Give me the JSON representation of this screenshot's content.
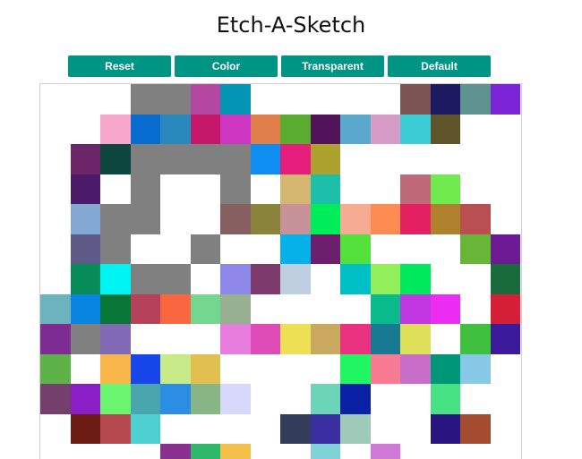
{
  "title": "Etch-A-Sketch",
  "accent_color": "#009485",
  "buttons": {
    "reset": "Reset",
    "color": "Color",
    "transparent": "Transparent",
    "default": "Default"
  },
  "grid": {
    "columns": 16,
    "rows": [
      [
        "#ffffff",
        "#ffffff",
        "#ffffff",
        "#808080",
        "#808080",
        "#b347a1",
        "#0494b4",
        "#ffffff",
        "#ffffff",
        "#ffffff",
        "#ffffff",
        "#ffffff",
        "#7c5451",
        "#1e1a62",
        "#5e9390",
        "#7b23d6"
      ],
      [
        "#ffffff",
        "#ffffff",
        "#f7a7cb",
        "#076bd0",
        "#2a89bc",
        "#c6186a",
        "#cc36c0",
        "#e17f4c",
        "#5aac31",
        "#51145a",
        "#5ba8cd",
        "#d69bc7",
        "#3dcdd6",
        "#60542b",
        "#ffffff",
        "#ffffff"
      ],
      [
        "#ffffff",
        "#6b2568",
        "#0d463e",
        "#808080",
        "#808080",
        "#808080",
        "#808080",
        "#0f8ef2",
        "#e61d7b",
        "#ada22e",
        "#ffffff",
        "#ffffff",
        "#ffffff",
        "#ffffff",
        "#ffffff",
        "#ffffff"
      ],
      [
        "#ffffff",
        "#4b1a69",
        "#ffffff",
        "#808080",
        "#ffffff",
        "#ffffff",
        "#808080",
        "#ffffff",
        "#d6b771",
        "#1cbfa8",
        "#ffffff",
        "#ffffff",
        "#c06976",
        "#70ea4d",
        "#ffffff",
        "#ffffff"
      ],
      [
        "#ffffff",
        "#83a8d4",
        "#808080",
        "#808080",
        "#ffffff",
        "#ffffff",
        "#866060",
        "#8a843a",
        "#c89299",
        "#00ed5b",
        "#f5ac92",
        "#fc8c52",
        "#e32162",
        "#b0812d",
        "#b94f50",
        "#ffffff"
      ],
      [
        "#ffffff",
        "#5e5a88",
        "#808080",
        "#ffffff",
        "#ffffff",
        "#808080",
        "#ffffff",
        "#ffffff",
        "#06b0e8",
        "#6c1f6d",
        "#55e13d",
        "#ffffff",
        "#ffffff",
        "#ffffff",
        "#69b537",
        "#6c1b95"
      ],
      [
        "#ffffff",
        "#078b59",
        "#00f4f4",
        "#808080",
        "#808080",
        "#ffffff",
        "#8d87e9",
        "#7c3a6d",
        "#bfcfe0",
        "#ffffff",
        "#00bfc5",
        "#93f05a",
        "#00e85c",
        "#ffffff",
        "#ffffff",
        "#1a6b3c"
      ],
      [
        "#6cb3bd",
        "#0885e0",
        "#077637",
        "#b5415b",
        "#f96741",
        "#73d88e",
        "#98b092",
        "#ffffff",
        "#ffffff",
        "#ffffff",
        "#ffffff",
        "#0abc8b",
        "#c236e1",
        "#ed2cf3",
        "#ffffff",
        "#d51f36"
      ],
      [
        "#7e2b94",
        "#808080",
        "#8269b5",
        "#ffffff",
        "#ffffff",
        "#ffffff",
        "#e77ede",
        "#e04cb7",
        "#eee055",
        "#c8a95f",
        "#ea3380",
        "#177a92",
        "#dfe05a",
        "#ffffff",
        "#3fc13f",
        "#3b1b9c"
      ],
      [
        "#5db347",
        "#ffffff",
        "#f9b64b",
        "#1747ea",
        "#c8ea89",
        "#e2c04f",
        "#ffffff",
        "#ffffff",
        "#ffffff",
        "#ffffff",
        "#20f662",
        "#f87a93",
        "#c86ec9",
        "#009779",
        "#88c9e7",
        "#ffffff"
      ],
      [
        "#753f6d",
        "#8b1ec7",
        "#69f56d",
        "#4aa6ad",
        "#2c8de5",
        "#87b583",
        "#d7d8fb",
        "#ffffff",
        "#ffffff",
        "#6cd5b8",
        "#0a21a5",
        "#ffffff",
        "#ffffff",
        "#47e284",
        "#ffffff",
        "#ffffff"
      ],
      [
        "#ffffff",
        "#6d1c14",
        "#b64950",
        "#4ed0d1",
        "#ffffff",
        "#ffffff",
        "#ffffff",
        "#ffffff",
        "#343c5c",
        "#3a2fa0",
        "#9fc9b9",
        "#ffffff",
        "#ffffff",
        "#28157f",
        "#a54b30",
        "#ffffff"
      ],
      [
        "#ffffff",
        "#ffffff",
        "#ffffff",
        "#ffffff",
        "#8a3090",
        "#2fb76a",
        "#f3c14b",
        "#ffffff",
        "#ffffff",
        "#7fd3d6",
        "#ffffff",
        "#cf79d9",
        "#ffffff",
        "#ffffff",
        "#ffffff",
        "#ffffff"
      ]
    ]
  }
}
